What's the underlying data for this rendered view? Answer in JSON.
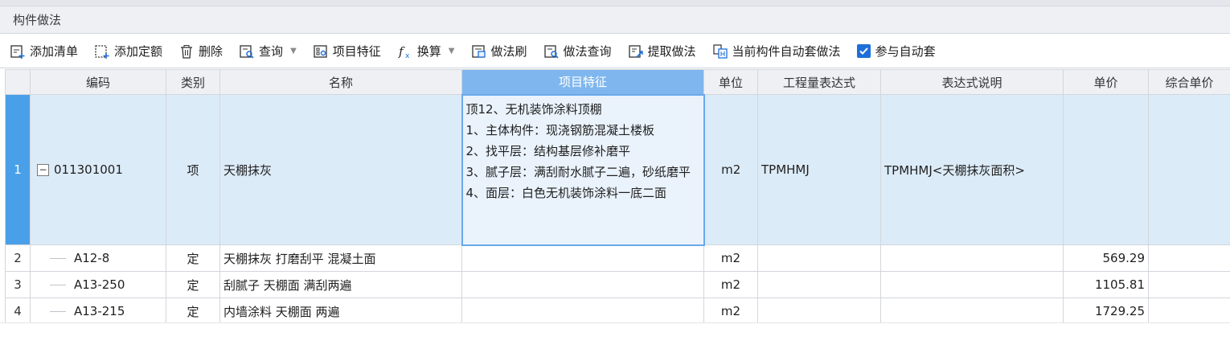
{
  "panel": {
    "title": "构件做法"
  },
  "toolbar": {
    "add_list": "添加清单",
    "add_quota": "添加定额",
    "delete": "删除",
    "query": "查询",
    "item_feature": "项目特征",
    "convert": "换算",
    "method_brush": "做法刷",
    "method_query": "做法查询",
    "extract_method": "提取做法",
    "auto_set_current": "当前构件自动套做法",
    "join_auto_set": "参与自动套",
    "join_auto_set_checked": true
  },
  "grid": {
    "headers": {
      "code": "编码",
      "type": "类别",
      "name": "名称",
      "feature": "项目特征",
      "unit": "单位",
      "expr": "工程量表达式",
      "expr_desc": "表达式说明",
      "price": "单价",
      "total_price": "综合单价"
    },
    "rows": [
      {
        "num": "1",
        "code": "011301001",
        "type": "项",
        "name": "天棚抹灰",
        "feature": "顶12、无机装饰涂料顶棚\n1、主体构件：现浇钢筋混凝土楼板\n2、找平层：结构基层修补磨平\n3、腻子层：满刮耐水腻子二遍，砂纸磨平\n4、面层：白色无机装饰涂料一底二面",
        "unit": "m2",
        "expr": "TPMHMJ",
        "expr_desc": "TPMHMJ<天棚抹灰面积>",
        "price": "",
        "total_price": ""
      },
      {
        "num": "2",
        "code": "A12-8",
        "type": "定",
        "name": "天棚抹灰 打磨刮平 混凝土面",
        "feature": "",
        "unit": "m2",
        "expr": "",
        "expr_desc": "",
        "price": "569.29",
        "total_price": ""
      },
      {
        "num": "3",
        "code": "A13-250",
        "type": "定",
        "name": "刮腻子 天棚面 满刮两遍",
        "feature": "",
        "unit": "m2",
        "expr": "",
        "expr_desc": "",
        "price": "1105.81",
        "total_price": ""
      },
      {
        "num": "4",
        "code": "A13-215",
        "type": "定",
        "name": "内墙涂料 天棚面 两遍",
        "feature": "",
        "unit": "m2",
        "expr": "",
        "expr_desc": "",
        "price": "1729.25",
        "total_price": ""
      }
    ]
  },
  "colors": {
    "accent": "#1e6fd9",
    "selected_header": "#7fb6ee",
    "selected_row": "#dcebf8",
    "row_marker": "#4aa0e8"
  }
}
